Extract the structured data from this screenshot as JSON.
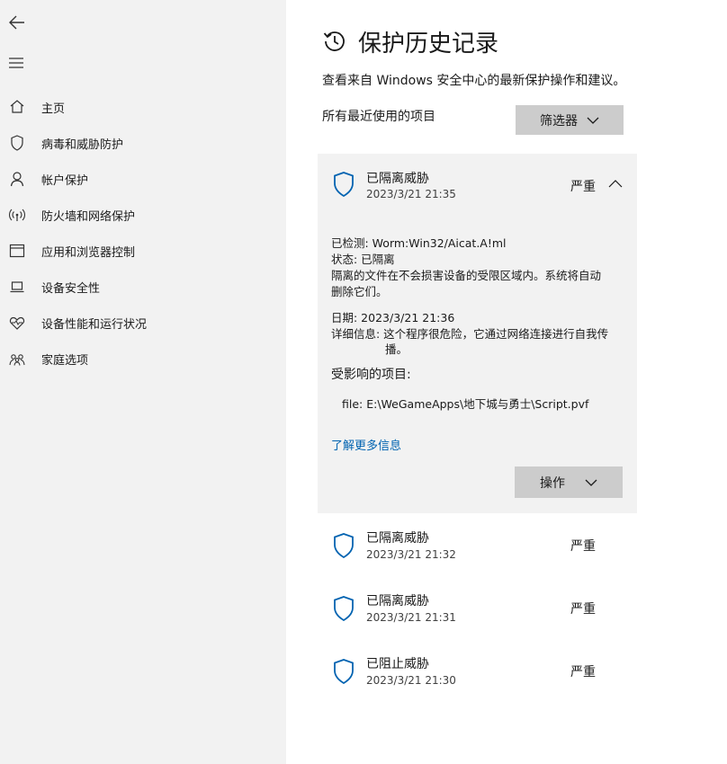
{
  "sidebar": {
    "items": [
      {
        "label": "主页",
        "icon": "home-icon"
      },
      {
        "label": "病毒和威胁防护",
        "icon": "shield-icon"
      },
      {
        "label": "帐户保护",
        "icon": "person-icon"
      },
      {
        "label": "防火墙和网络保护",
        "icon": "wifi-icon"
      },
      {
        "label": "应用和浏览器控制",
        "icon": "browser-icon"
      },
      {
        "label": "设备安全性",
        "icon": "laptop-icon"
      },
      {
        "label": "设备性能和运行状况",
        "icon": "heart-icon"
      },
      {
        "label": "家庭选项",
        "icon": "family-icon"
      }
    ]
  },
  "header": {
    "title": "保护历史记录",
    "subtitle": "查看来自 Windows 安全中心的最新保护操作和建议。"
  },
  "filter": {
    "section_label": "所有最近使用的项目",
    "button_label": "筛选器"
  },
  "expanded": {
    "title": "已隔离威胁",
    "date": "2023/3/21 21:35",
    "severity": "严重",
    "detected": "已检测:  Worm:Win32/Aicat.A!ml",
    "status": "状态: 已隔离",
    "desc_line1": "隔离的文件在不会损害设备的受限区域内。系统将自动",
    "desc_line2": "删除它们。",
    "date_line": "日期:  2023/3/21 21:36",
    "detail_line1": "详细信息:  这个程序很危险，它通过网络连接进行自我传",
    "detail_line2": "播。",
    "affected_label": "受影响的项目:",
    "affected_file": "file: E:\\WeGameApps\\地下城与勇士\\Script.pvf",
    "learn_more": "了解更多信息",
    "action_label": "操作"
  },
  "rows": [
    {
      "title": "已隔离威胁",
      "date": "2023/3/21 21:32",
      "severity": "严重"
    },
    {
      "title": "已隔离威胁",
      "date": "2023/3/21 21:31",
      "severity": "严重"
    },
    {
      "title": "已阻止威胁",
      "date": "2023/3/21 21:30",
      "severity": "严重"
    }
  ],
  "colors": {
    "accent": "#0063b1",
    "sidebar_bg": "#f2f2f2",
    "button_bg": "#cccccc"
  }
}
